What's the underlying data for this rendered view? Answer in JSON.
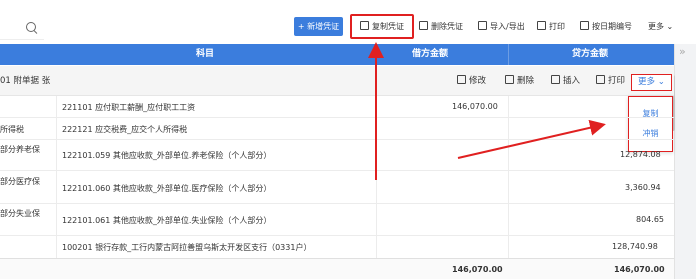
{
  "toolbar": {
    "new_voucher": "+ 新增凭证",
    "copy_voucher": "复制凭证",
    "delete_voucher": "删除凭证",
    "import_export": "导入/导出",
    "print": "打印",
    "by_date_number": "按日期编号",
    "more": "更多"
  },
  "grid_header": {
    "subject": "科目",
    "debit": "借方金额",
    "credit": "贷方金额"
  },
  "voucher_row": {
    "label": "01   附单据 张",
    "modify": "修改",
    "delete": "删除",
    "insert": "插入",
    "print": "打印",
    "more": "更多"
  },
  "dropdown": {
    "items": [
      "复制",
      "冲销"
    ]
  },
  "rows": [
    {
      "summary": "",
      "subject": "221101  应付职工薪酬_应付职工工资",
      "debit": "146,070.00",
      "credit": ""
    },
    {
      "summary": "所得税",
      "subject": "222121  应交税费_应交个人所得税",
      "debit": "",
      "credit": ""
    },
    {
      "summary": "部分养老保",
      "subject": "122101.059  其他应收款_外部单位.养老保险（个人部分）",
      "debit": "",
      "credit": "12,874.08"
    },
    {
      "summary": "部分医疗保",
      "subject": "122101.060  其他应收款_外部单位.医疗保险（个人部分）",
      "debit": "",
      "credit": "3,360.94"
    },
    {
      "summary": "部分失业保",
      "subject": "122101.061  其他应收款_外部单位.失业保险（个人部分）",
      "debit": "",
      "credit": "804.65"
    },
    {
      "summary": "",
      "subject": "100201  银行存款_工行内蒙古阿拉善盟乌斯太开发区支行（0331户）",
      "debit": "",
      "credit": "128,740.98"
    }
  ],
  "totals": {
    "debit": "146,070.00",
    "credit": "146,070.00"
  },
  "colors": {
    "primary": "#3b7ddd",
    "highlight": "#e02020"
  }
}
